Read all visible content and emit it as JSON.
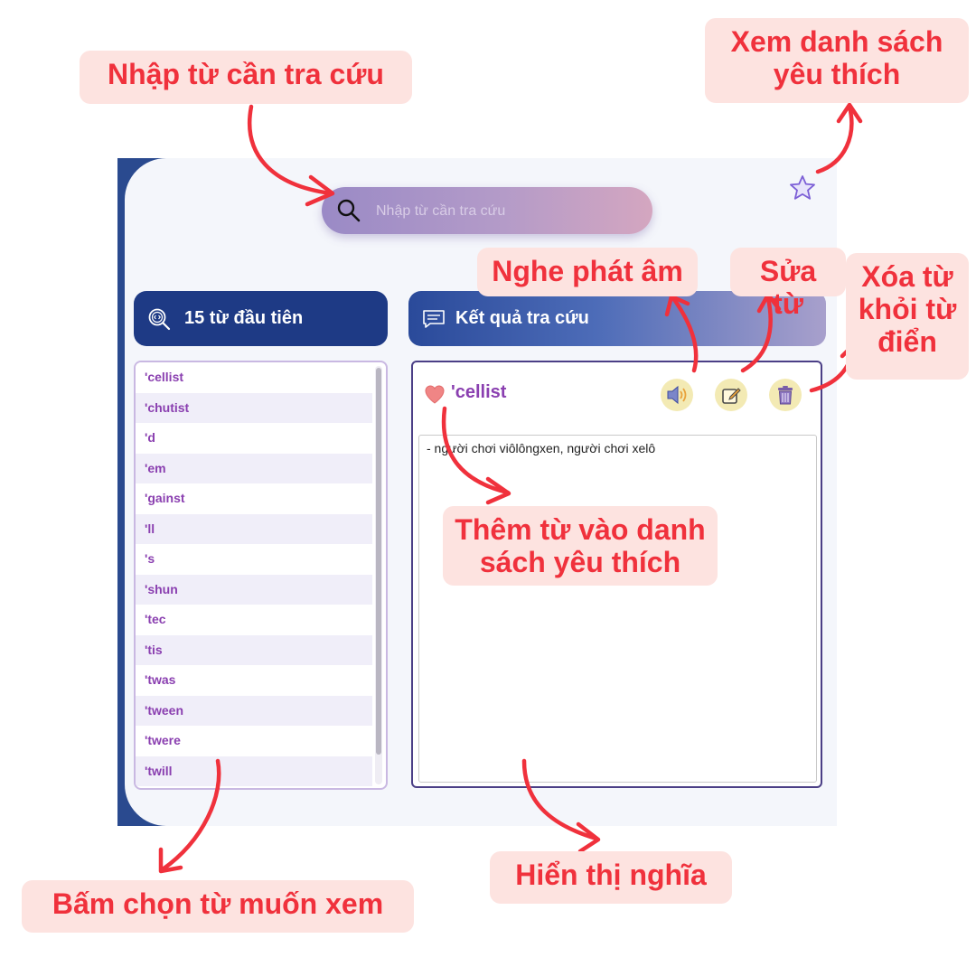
{
  "search": {
    "placeholder": "Nhập từ cần tra cứu",
    "value": ""
  },
  "word_list_panel": {
    "title": "15 từ đầu tiên",
    "words": [
      "'cellist",
      "'chutist",
      "'d",
      "'em",
      "'gainst",
      "'ll",
      "'s",
      "'shun",
      "'tec",
      "'tis",
      "'twas",
      "'tween",
      "'twere",
      "'twill"
    ]
  },
  "result_panel": {
    "title": "Kết quả tra cứu",
    "word": "'cellist",
    "meaning": "- người chơi viôlôngxen, người chơi xelô"
  },
  "icons": {
    "search": "search-icon",
    "favorites": "star-icon",
    "list_header": "magnifier-code-icon",
    "result_header": "message-lines-icon",
    "favorite_toggle": "heart-icon",
    "pronounce": "speaker-icon",
    "edit": "edit-icon",
    "delete": "trash-icon"
  },
  "annotations": {
    "search": "Nhập từ cần tra cứu",
    "favorites_list": [
      "Xem danh sách",
      "yêu thích"
    ],
    "pronounce": "Nghe phát âm",
    "edit": "Sửa từ",
    "delete": [
      "Xóa từ",
      "khỏi từ",
      "điển"
    ],
    "add_favorite": [
      "Thêm từ vào danh",
      "sách yêu thích"
    ],
    "select_word": "Bấm chọn từ muốn xem",
    "show_meaning": "Hiển thị nghĩa"
  },
  "colors": {
    "annotation_text": "#f0313c",
    "annotation_bg": "#fde3e0",
    "primary_navy": "#1e3a85",
    "word_purple": "#8a3fb0"
  }
}
